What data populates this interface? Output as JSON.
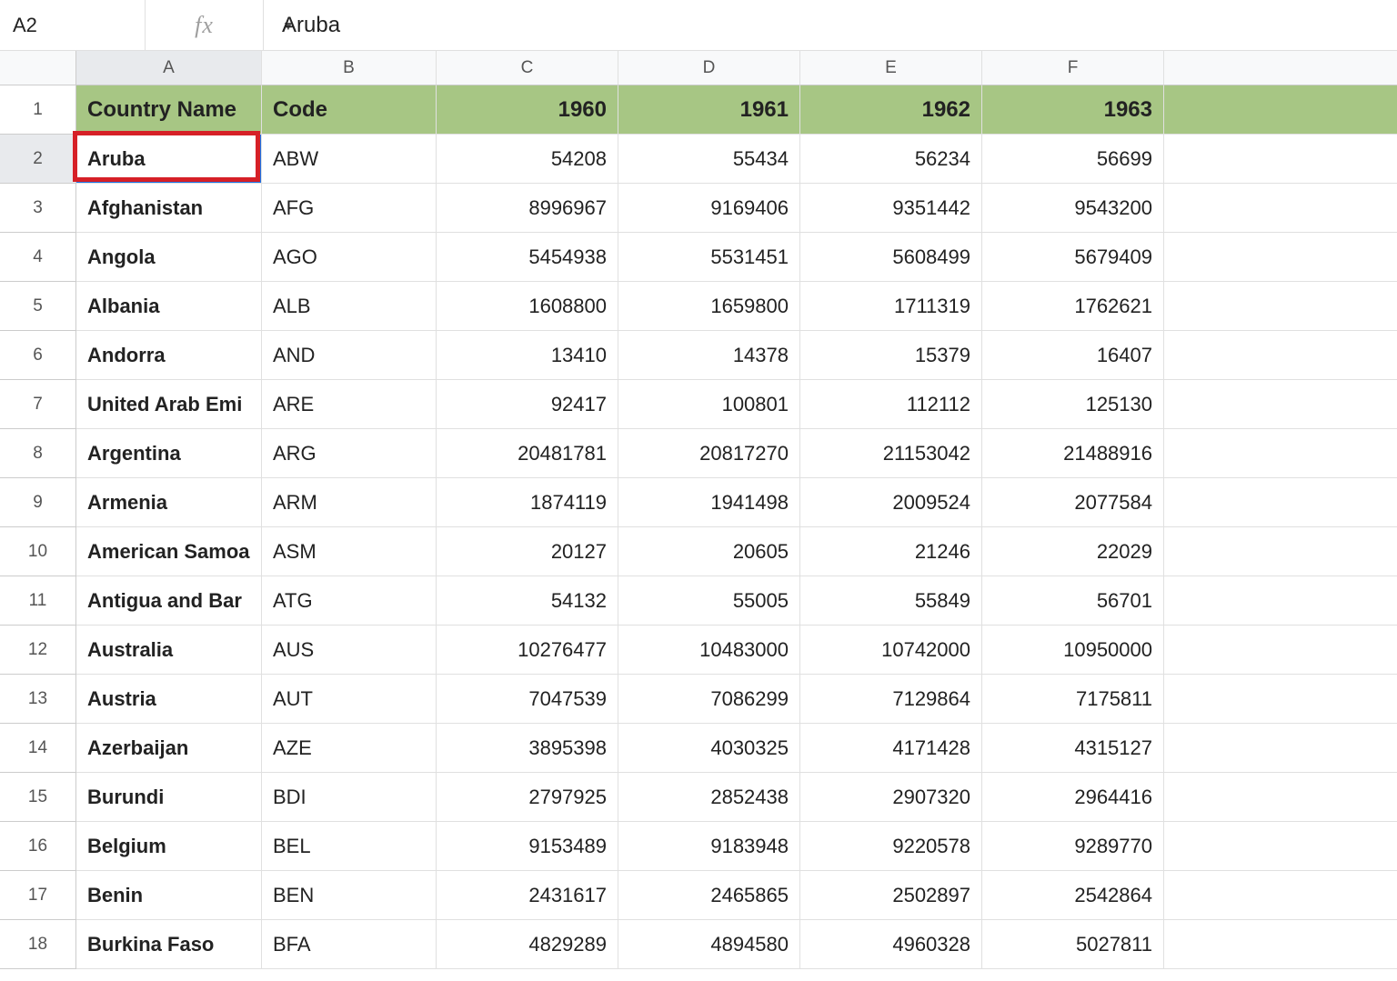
{
  "namebox": {
    "value": "A2"
  },
  "fx_label": "fx",
  "formula_bar": {
    "value": "Aruba"
  },
  "columns": [
    "A",
    "B",
    "C",
    "D",
    "E",
    "F"
  ],
  "selected_column": "A",
  "selected_row": "2",
  "active_cell": {
    "row": 2,
    "col": "A"
  },
  "highlight_box": {
    "row": 2,
    "col": "A"
  },
  "row_numbers": [
    "1",
    "2",
    "3",
    "4",
    "5",
    "6",
    "7",
    "8",
    "9",
    "10",
    "11",
    "12",
    "13",
    "14",
    "15",
    "16",
    "17",
    "18"
  ],
  "header_row": {
    "A": "Country Name",
    "B": "Code",
    "C": "1960",
    "D": "1961",
    "E": "1962",
    "F": "1963"
  },
  "rows": [
    {
      "A": "Aruba",
      "B": "ABW",
      "C": "54208",
      "D": "55434",
      "E": "56234",
      "F": "56699"
    },
    {
      "A": "Afghanistan",
      "B": "AFG",
      "C": "8996967",
      "D": "9169406",
      "E": "9351442",
      "F": "9543200"
    },
    {
      "A": "Angola",
      "B": "AGO",
      "C": "5454938",
      "D": "5531451",
      "E": "5608499",
      "F": "5679409"
    },
    {
      "A": "Albania",
      "B": "ALB",
      "C": "1608800",
      "D": "1659800",
      "E": "1711319",
      "F": "1762621"
    },
    {
      "A": "Andorra",
      "B": "AND",
      "C": "13410",
      "D": "14378",
      "E": "15379",
      "F": "16407"
    },
    {
      "A": "United Arab Emi",
      "B": "ARE",
      "C": "92417",
      "D": "100801",
      "E": "112112",
      "F": "125130"
    },
    {
      "A": "Argentina",
      "B": "ARG",
      "C": "20481781",
      "D": "20817270",
      "E": "21153042",
      "F": "21488916"
    },
    {
      "A": "Armenia",
      "B": "ARM",
      "C": "1874119",
      "D": "1941498",
      "E": "2009524",
      "F": "2077584"
    },
    {
      "A": "American Samoa",
      "B": "ASM",
      "C": "20127",
      "D": "20605",
      "E": "21246",
      "F": "22029"
    },
    {
      "A": "Antigua and Bar",
      "B": "ATG",
      "C": "54132",
      "D": "55005",
      "E": "55849",
      "F": "56701"
    },
    {
      "A": "Australia",
      "B": "AUS",
      "C": "10276477",
      "D": "10483000",
      "E": "10742000",
      "F": "10950000"
    },
    {
      "A": "Austria",
      "B": "AUT",
      "C": "7047539",
      "D": "7086299",
      "E": "7129864",
      "F": "7175811"
    },
    {
      "A": "Azerbaijan",
      "B": "AZE",
      "C": "3895398",
      "D": "4030325",
      "E": "4171428",
      "F": "4315127"
    },
    {
      "A": "Burundi",
      "B": "BDI",
      "C": "2797925",
      "D": "2852438",
      "E": "2907320",
      "F": "2964416"
    },
    {
      "A": "Belgium",
      "B": "BEL",
      "C": "9153489",
      "D": "9183948",
      "E": "9220578",
      "F": "9289770"
    },
    {
      "A": "Benin",
      "B": "BEN",
      "C": "2431617",
      "D": "2465865",
      "E": "2502897",
      "F": "2542864"
    },
    {
      "A": "Burkina Faso",
      "B": "BFA",
      "C": "4829289",
      "D": "4894580",
      "E": "4960328",
      "F": "5027811"
    }
  ]
}
